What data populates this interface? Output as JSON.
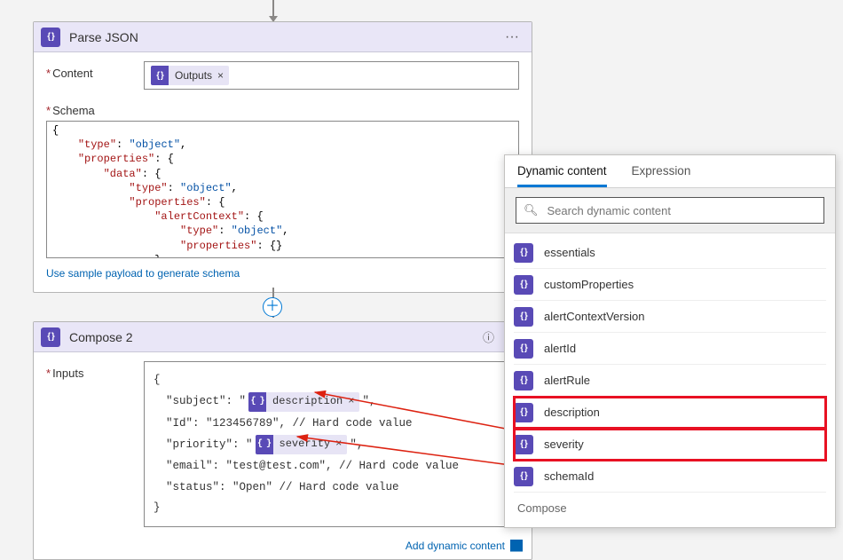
{
  "connectorTop": true,
  "parseJson": {
    "title": "Parse JSON",
    "contentLabel": "Content",
    "contentToken": "Outputs",
    "schemaLabel": "Schema",
    "schemaRaw": "{\n    \"type\": \"object\",\n    \"properties\": {\n        \"data\": {\n            \"type\": \"object\",\n            \"properties\": {\n                \"alertContext\": {\n                    \"type\": \"object\",\n                    \"properties\": {}\n                }",
    "sampleLink": "Use sample payload to generate schema"
  },
  "compose": {
    "title": "Compose 2",
    "inputsLabel": "Inputs",
    "lines": {
      "open": "{",
      "subject_k": "\"subject\": \"",
      "subject_tok": "description",
      "subject_tail": "\",",
      "id": "\"Id\": \"123456789\", // Hard code value",
      "priority_k": "\"priority\": \"",
      "priority_tok": "severity",
      "priority_tail": "\",",
      "email": "\"email\": \"test@test.com\",   // Hard code value",
      "status": "\"status\": \"Open\"  // Hard code value",
      "close": "}"
    },
    "addDynamic": "Add dynamic content"
  },
  "popover": {
    "tabDynamic": "Dynamic content",
    "tabExpression": "Expression",
    "searchPlaceholder": "Search dynamic content",
    "items": [
      {
        "label": "essentials",
        "hl": false
      },
      {
        "label": "customProperties",
        "hl": false
      },
      {
        "label": "alertContextVersion",
        "hl": false
      },
      {
        "label": "alertId",
        "hl": false
      },
      {
        "label": "alertRule",
        "hl": false
      },
      {
        "label": "description",
        "hl": true
      },
      {
        "label": "severity",
        "hl": true
      },
      {
        "label": "schemaId",
        "hl": false
      }
    ],
    "groupHeading": "Compose"
  }
}
